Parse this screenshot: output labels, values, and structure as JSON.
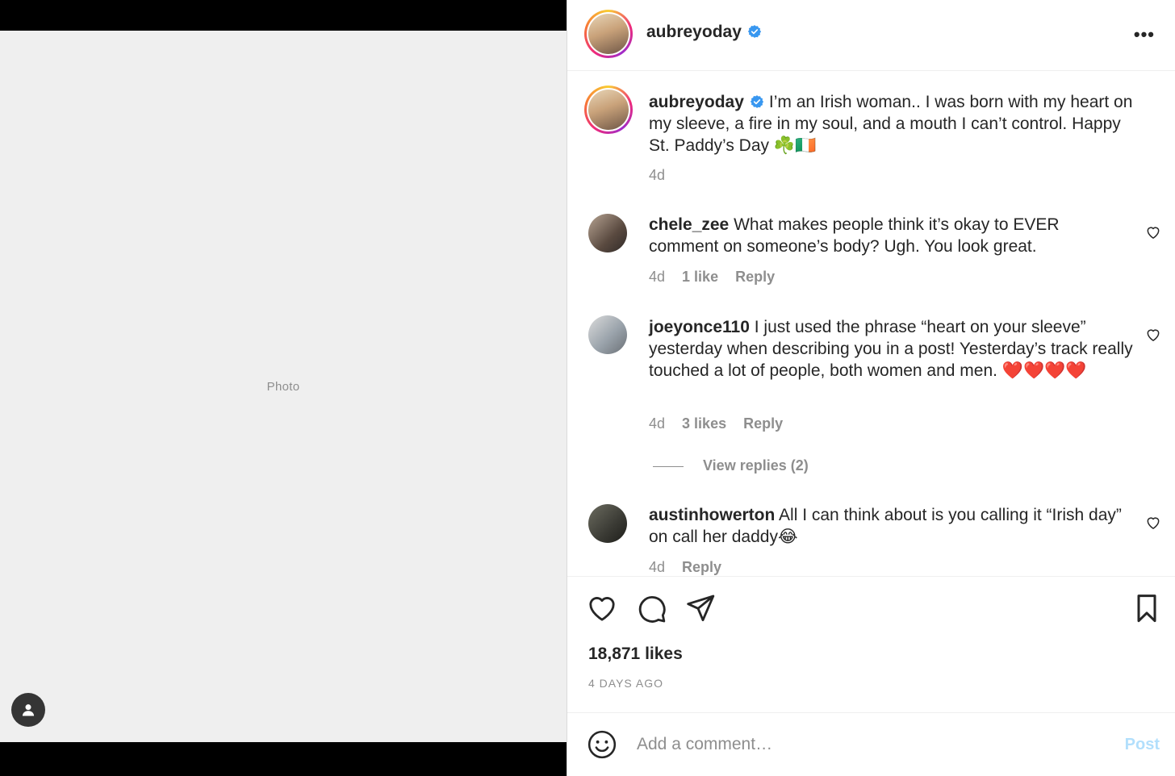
{
  "media": {
    "placeholder": "Photo"
  },
  "post_header": {
    "username": "aubreyoday",
    "more_label": "•••"
  },
  "caption": {
    "username": "aubreyoday",
    "text": "I’m an Irish woman.. I was born with my heart on my sleeve, a fire in my soul, and a mouth I can’t control. Happy St. Paddy’s Day ☘️🇮🇪",
    "time": "4d"
  },
  "comments": [
    {
      "username": "chele_zee",
      "text": "What makes people think it’s okay to EVER comment on someone’s body? Ugh. You look great.",
      "time": "4d",
      "likes": "1 like",
      "reply": "Reply"
    },
    {
      "username": "joeyonce110",
      "text": "I just used the phrase “heart on your sleeve” yesterday when describing you in a post! Yesterday’s track really touched a lot of people, both women and men. ❤️❤️❤️❤️",
      "time": "4d",
      "likes": "3 likes",
      "reply": "Reply",
      "view_replies": "View replies (2)"
    },
    {
      "username": "austinhowerton",
      "text": "All I can think about is you calling it “Irish day” on call her daddy😂",
      "time": "4d",
      "reply": "Reply"
    }
  ],
  "engagement": {
    "likes": "18,871 likes",
    "posted_ago": "4 DAYS AGO"
  },
  "comment_box": {
    "placeholder": "Add a comment…",
    "post_label": "Post"
  },
  "colors": {
    "verified": "#3897f0",
    "post_button_disabled": "#b2dffc",
    "secondary_text": "#8e8e8e"
  },
  "icons": [
    "user-tag-icon",
    "verified-badge-icon",
    "more-options-icon",
    "heart-icon",
    "comment-icon",
    "share-icon",
    "bookmark-icon",
    "emoji-icon"
  ]
}
